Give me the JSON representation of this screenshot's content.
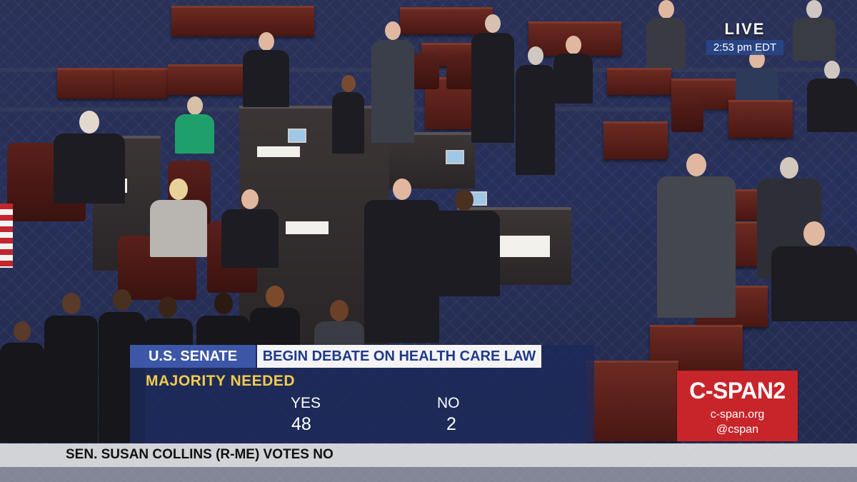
{
  "broadcast": {
    "live_label": "LIVE",
    "live_time": "2:53 pm EDT"
  },
  "vote_graphic": {
    "chamber": "U.S. SENATE",
    "measure": "BEGIN DEBATE ON HEALTH CARE LAW",
    "threshold": "MAJORITY NEEDED",
    "yes_label": "YES",
    "yes_count": "48",
    "no_label": "NO",
    "no_count": "2"
  },
  "network_logo": {
    "name": "C-SPAN2",
    "site": "c-span.org",
    "handle": "@cspan"
  },
  "lower_third": {
    "caption": "SEN. SUSAN COLLINS (R-ME) VOTES NO"
  },
  "colors": {
    "chamber_label_bg": "#3d57a8",
    "measure_text": "#1f3a8a",
    "threshold_text": "#f2cb4e",
    "logo_bg": "#c8252b"
  }
}
